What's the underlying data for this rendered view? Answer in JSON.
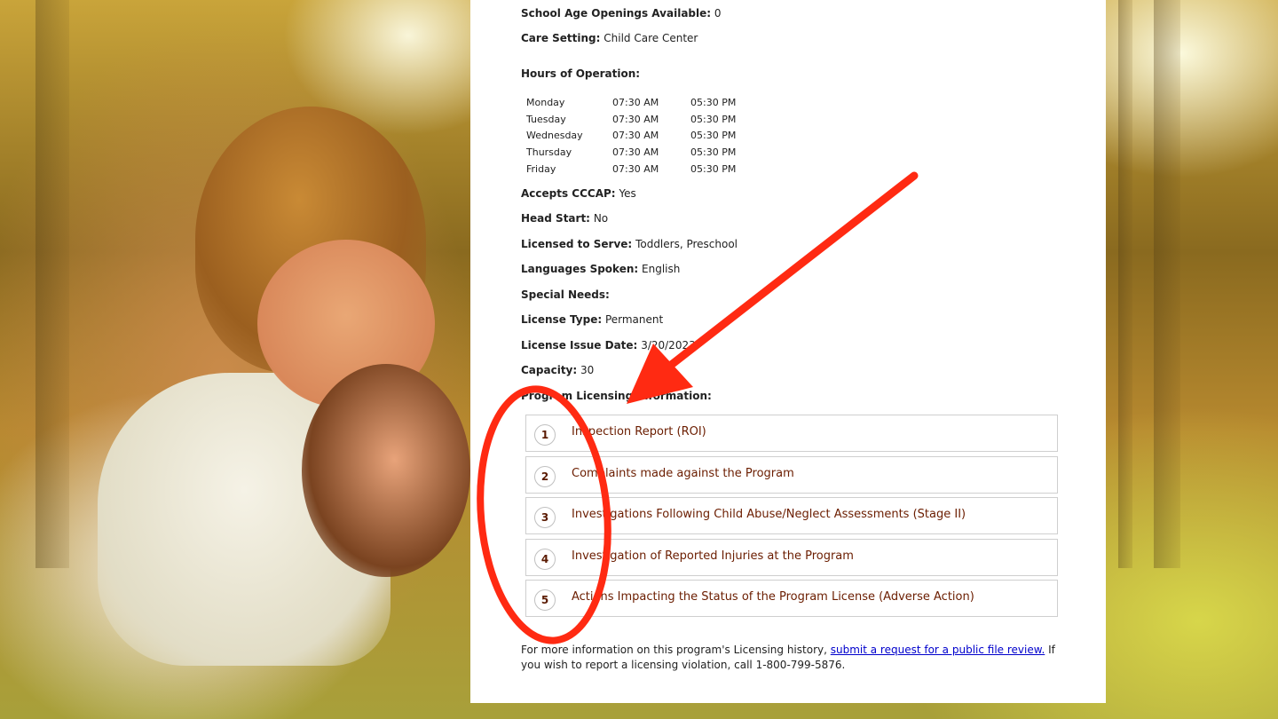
{
  "details": {
    "school_age_label": "School Age Openings Available:",
    "school_age_value": "0",
    "care_setting_label": "Care Setting:",
    "care_setting_value": "Child Care Center",
    "hours_label": "Hours of Operation:",
    "hours": [
      {
        "day": "Monday",
        "open": "07:30 AM",
        "close": "05:30 PM"
      },
      {
        "day": "Tuesday",
        "open": "07:30 AM",
        "close": "05:30 PM"
      },
      {
        "day": "Wednesday",
        "open": "07:30 AM",
        "close": "05:30 PM"
      },
      {
        "day": "Thursday",
        "open": "07:30 AM",
        "close": "05:30 PM"
      },
      {
        "day": "Friday",
        "open": "07:30 AM",
        "close": "05:30 PM"
      }
    ],
    "cccap_label": "Accepts CCCAP:",
    "cccap_value": "Yes",
    "head_start_label": "Head Start:",
    "head_start_value": "No",
    "licensed_label": "Licensed to Serve:",
    "licensed_value": "Toddlers, Preschool",
    "languages_label": "Languages Spoken:",
    "languages_value": "English",
    "special_needs_label": "Special Needs:",
    "special_needs_value": "",
    "license_type_label": "License Type:",
    "license_type_value": "Permanent",
    "issue_date_label": "License Issue Date:",
    "issue_date_value": "3/20/2023",
    "capacity_label": "Capacity:",
    "capacity_value": "30",
    "program_licensing_label": "Program Licensing Information:"
  },
  "accordion": [
    {
      "num": "1",
      "title": "Inspection Report (ROI)"
    },
    {
      "num": "2",
      "title": "Complaints made against the Program"
    },
    {
      "num": "3",
      "title": "Investigations Following Child Abuse/Neglect Assessments (Stage II)"
    },
    {
      "num": "4",
      "title": "Investigation of Reported Injuries at the Program"
    },
    {
      "num": "5",
      "title": "Actions Impacting the Status of the Program License (Adverse Action)"
    }
  ],
  "footer": {
    "text_before": "For more information on this program's Licensing history,",
    "link": "submit a request for a public file review.",
    "text_after": "If you wish to report a licensing violation, call 1-800-799-5876."
  },
  "colors": {
    "annotation": "#ff2a12",
    "accordion_title": "#6b1d00",
    "link": "#0000cc"
  }
}
